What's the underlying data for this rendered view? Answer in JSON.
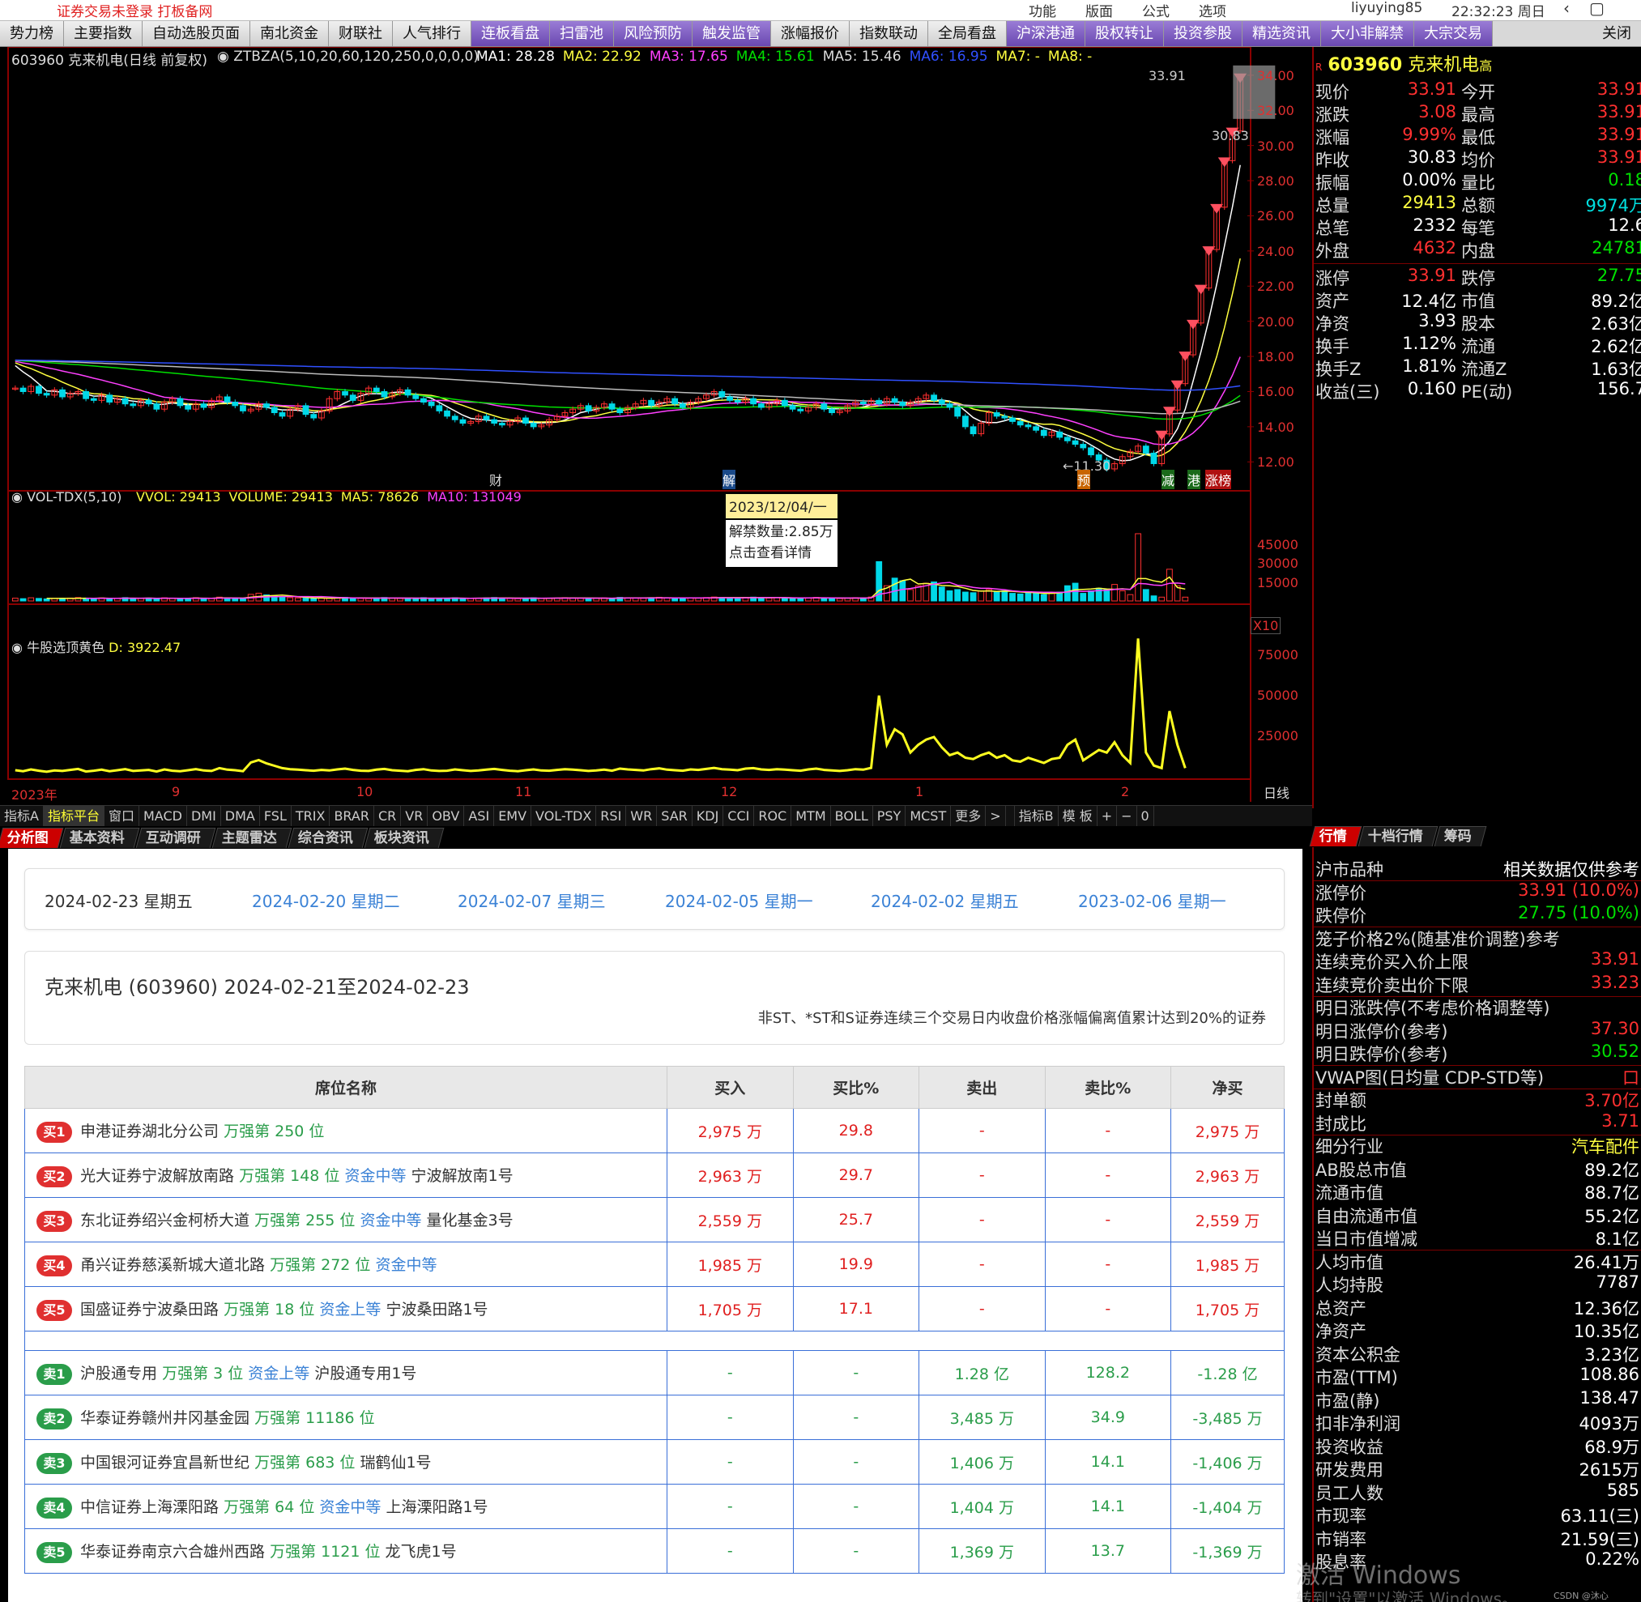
{
  "sysbar": {
    "warning": "证券交易未登录  打板备网",
    "menu": [
      "功能",
      "版面",
      "公式",
      "选项"
    ],
    "user": "liyuying85",
    "clock": "22:32:23 周日"
  },
  "tabs": [
    {
      "label": "势力榜",
      "hl": false
    },
    {
      "label": "主要指数",
      "hl": false
    },
    {
      "label": "自动选股页面",
      "hl": false
    },
    {
      "label": "南北资金",
      "hl": false
    },
    {
      "label": "财联社",
      "hl": false
    },
    {
      "label": "人气排行",
      "hl": false
    },
    {
      "label": "连板看盘",
      "hl": true
    },
    {
      "label": "扫雷池",
      "hl": true
    },
    {
      "label": "风险预防",
      "hl": true
    },
    {
      "label": "触发监管",
      "hl": true
    },
    {
      "label": "涨幅报价",
      "hl": false
    },
    {
      "label": "指数联动",
      "hl": false
    },
    {
      "label": "全局看盘",
      "hl": false
    },
    {
      "label": "沪深港通",
      "hl": true
    },
    {
      "label": "股权转让",
      "hl": true
    },
    {
      "label": "投资参股",
      "hl": true
    },
    {
      "label": "精选资讯",
      "hl": true
    },
    {
      "label": "大小非解禁",
      "hl": true
    },
    {
      "label": "大宗交易",
      "hl": true
    }
  ],
  "tab_close": "关闭",
  "kline": {
    "header": "603960 克来机电(日线 前复权)",
    "formula": "ZTBZA(5,10,20,60,120,250,0,0,0,0)",
    "ma": [
      {
        "label": "MA1: 28.28",
        "color": "#ffffff"
      },
      {
        "label": "MA2: 22.92",
        "color": "#ffff40"
      },
      {
        "label": "MA3: 17.65",
        "color": "#ff40ff"
      },
      {
        "label": "MA4: 15.61",
        "color": "#00e000"
      },
      {
        "label": "MA5: 15.46",
        "color": "#dddddd"
      },
      {
        "label": "MA6: 16.95",
        "color": "#3050ff"
      },
      {
        "label": "MA7: -",
        "color": "#ffff40"
      },
      {
        "label": "MA8: -",
        "color": "#ffff40"
      }
    ],
    "yticks": [
      "34.00",
      "32.00",
      "30.00",
      "28.00",
      "26.00",
      "24.00",
      "22.00",
      "20.00",
      "18.00",
      "16.00",
      "14.00",
      "12.00"
    ],
    "annotations": {
      "high": "33.91",
      "pre": "30.83",
      "low": "11.30"
    },
    "markers": [
      {
        "text": "财"
      },
      {
        "text": "解"
      },
      {
        "text": "预"
      },
      {
        "text": "减"
      },
      {
        "text": "港"
      },
      {
        "text": "涨榜"
      }
    ]
  },
  "tooltip": {
    "date": "2023/12/04/一",
    "line1": "解禁数量:2.85万",
    "line2": "点击查看详情"
  },
  "vol": {
    "header": "VOL-TDX(5,10)",
    "items": [
      {
        "label": "VVOL: 29413",
        "color": "#ffff40"
      },
      {
        "label": "VOLUME: 29413",
        "color": "#ffff40"
      },
      {
        "label": "MA5: 78626",
        "color": "#ffff40"
      },
      {
        "label": "MA10: 131049",
        "color": "#ff40ff"
      }
    ],
    "yticks": [
      "45000",
      "30000",
      "15000"
    ],
    "unit": "X10"
  },
  "osc": {
    "header": "牛股选顶黄色",
    "value": "D: 3922.47",
    "yticks": [
      "75000",
      "50000",
      "25000"
    ]
  },
  "xaxis": [
    "2023年",
    "9",
    "10",
    "11",
    "12",
    "1",
    "2"
  ],
  "period": "日线",
  "indicators": [
    "指标A",
    "指标平台",
    "窗口",
    "MACD",
    "DMI",
    "DMA",
    "FSL",
    "TRIX",
    "BRAR",
    "CR",
    "VR",
    "OBV",
    "ASI",
    "EMV",
    "VOL-TDX",
    "RSI",
    "WR",
    "SAR",
    "KDJ",
    "CCI",
    "ROC",
    "MTM",
    "BOLL",
    "PSY",
    "MCST",
    "更多",
    ">",
    "",
    "指标B",
    "模 板",
    "+",
    "−",
    "0"
  ],
  "subtabs": [
    "分析图",
    "基本资料",
    "互动调研",
    "主题雷达",
    "综合资讯",
    "板块资讯"
  ],
  "web": {
    "dates": [
      "2024-02-23 星期五",
      "2024-02-20 星期二",
      "2024-02-07 星期三",
      "2024-02-05 星期一",
      "2024-02-02 星期五",
      "2023-02-06 星期一"
    ],
    "title": "克来机电 (603960) 2024-02-21至2024-02-23",
    "reason": "非ST、*ST和S证券连续三个交易日内收盘价格涨幅偏离值累计达到20%的证券",
    "headers": [
      "席位名称",
      "买入",
      "买比%",
      "卖出",
      "卖比%",
      "净买"
    ],
    "buys": [
      {
        "badge": "买1",
        "name": "申港证券湖北分公司",
        "rank": "万强第 250 位",
        "level": "",
        "tag": "",
        "buy": "2,975 万",
        "buy_pct": "29.8",
        "sell": "-",
        "sell_pct": "-",
        "net": "2,975 万"
      },
      {
        "badge": "买2",
        "name": "光大证券宁波解放南路",
        "rank": "万强第 148 位",
        "level": "资金中等",
        "tag": "宁波解放南1号",
        "buy": "2,963 万",
        "buy_pct": "29.7",
        "sell": "-",
        "sell_pct": "-",
        "net": "2,963 万"
      },
      {
        "badge": "买3",
        "name": "东北证券绍兴金柯桥大道",
        "rank": "万强第 255 位",
        "level": "资金中等",
        "tag": "量化基金3号",
        "buy": "2,559 万",
        "buy_pct": "25.7",
        "sell": "-",
        "sell_pct": "-",
        "net": "2,559 万"
      },
      {
        "badge": "买4",
        "name": "甬兴证券慈溪新城大道北路",
        "rank": "万强第 272 位",
        "level": "资金中等",
        "tag": "",
        "buy": "1,985 万",
        "buy_pct": "19.9",
        "sell": "-",
        "sell_pct": "-",
        "net": "1,985 万"
      },
      {
        "badge": "买5",
        "name": "国盛证券宁波桑田路",
        "rank": "万强第 18 位",
        "level": "资金上等",
        "tag": "宁波桑田路1号",
        "buy": "1,705 万",
        "buy_pct": "17.1",
        "sell": "-",
        "sell_pct": "-",
        "net": "1,705 万"
      }
    ],
    "sells": [
      {
        "badge": "卖1",
        "name": "沪股通专用",
        "rank": "万强第 3 位",
        "level": "资金上等",
        "tag": "沪股通专用1号",
        "buy": "-",
        "buy_pct": "-",
        "sell": "1.28 亿",
        "sell_pct": "128.2",
        "net": "-1.28 亿"
      },
      {
        "badge": "卖2",
        "name": "华泰证券赣州井冈基金园",
        "rank": "万强第 11186 位",
        "level": "",
        "tag": "",
        "buy": "-",
        "buy_pct": "-",
        "sell": "3,485 万",
        "sell_pct": "34.9",
        "net": "-3,485 万"
      },
      {
        "badge": "卖3",
        "name": "中国银河证券宜昌新世纪",
        "rank": "万强第 683 位",
        "level": "",
        "tag": "瑞鹤仙1号",
        "buy": "-",
        "buy_pct": "-",
        "sell": "1,406 万",
        "sell_pct": "14.1",
        "net": "-1,406 万"
      },
      {
        "badge": "卖4",
        "name": "中信证券上海溧阳路",
        "rank": "万强第 64 位",
        "level": "资金中等",
        "tag": "上海溧阳路1号",
        "buy": "-",
        "buy_pct": "-",
        "sell": "1,404 万",
        "sell_pct": "14.1",
        "net": "-1,404 万"
      },
      {
        "badge": "卖5",
        "name": "华泰证券南京六合雄州西路",
        "rank": "万强第 1121 位",
        "level": "",
        "tag": "龙飞虎1号",
        "buy": "-",
        "buy_pct": "-",
        "sell": "1,369 万",
        "sell_pct": "13.7",
        "net": "-1,369 万"
      }
    ]
  },
  "quote": {
    "code": "603960",
    "name": "克来机电",
    "flag": "R",
    "suffix": "高",
    "rows": [
      {
        "l": "现价",
        "v": "33.91",
        "vc": "red",
        "l2": "今开",
        "v2": "33.91",
        "v2c": "red"
      },
      {
        "l": "涨跌",
        "v": "3.08",
        "vc": "red",
        "l2": "最高",
        "v2": "33.91",
        "v2c": "red"
      },
      {
        "l": "涨幅",
        "v": "9.99%",
        "vc": "red",
        "l2": "最低",
        "v2": "33.91",
        "v2c": "red"
      },
      {
        "l": "昨收",
        "v": "30.83",
        "vc": "wht",
        "l2": "均价",
        "v2": "33.91",
        "v2c": "red"
      },
      {
        "l": "振幅",
        "v": "0.00%",
        "vc": "wht",
        "l2": "量比",
        "v2": "0.18",
        "v2c": "grn"
      },
      {
        "l": "总量",
        "v": "29413",
        "vc": "yel",
        "l2": "总额",
        "v2": "9974万",
        "v2c": "cyan"
      },
      {
        "l": "总笔",
        "v": "2332",
        "vc": "wht",
        "l2": "每笔",
        "v2": "12.6",
        "v2c": "wht"
      },
      {
        "l": "外盘",
        "v": "4632",
        "vc": "red",
        "l2": "内盘",
        "v2": "24781",
        "v2c": "grn"
      },
      {
        "l": "涨停",
        "v": "33.91",
        "vc": "red",
        "l2": "跌停",
        "v2": "27.75",
        "v2c": "grn"
      },
      {
        "l": "资产",
        "v": "12.4亿",
        "vc": "wht",
        "l2": "市值",
        "v2": "89.2亿",
        "v2c": "wht"
      },
      {
        "l": "净资",
        "v": "3.93",
        "vc": "wht",
        "l2": "股本",
        "v2": "2.63亿",
        "v2c": "wht"
      },
      {
        "l": "换手",
        "v": "1.12%",
        "vc": "wht",
        "l2": "流通",
        "v2": "2.62亿",
        "v2c": "wht"
      },
      {
        "l": "换手Z",
        "v": "1.81%",
        "vc": "wht",
        "l2": "流通Z",
        "v2": "1.63亿",
        "v2c": "wht"
      },
      {
        "l": "收益(三)",
        "v": "0.160",
        "vc": "wht",
        "l2": "PE(动)",
        "v2": "156.7",
        "v2c": "wht"
      }
    ]
  },
  "qtabs": [
    "行情",
    "十档行情",
    "筹码"
  ],
  "detail": {
    "rows": [
      {
        "l": "沪市品种",
        "v": "相关数据仅供参考",
        "c": "wht"
      },
      {
        "l": "涨停价",
        "v": "33.91 (10.0%)",
        "c": "red"
      },
      {
        "l": "跌停价",
        "v": "27.75 (10.0%)",
        "c": "grn"
      },
      {
        "l": "笼子价格2%(随基准价调整)参考",
        "v": "",
        "c": "wht"
      },
      {
        "l": "连续竞价买入价上限",
        "v": "33.91",
        "c": "red"
      },
      {
        "l": "连续竞价卖出价下限",
        "v": "33.23",
        "c": "red"
      },
      {
        "l": "明日涨跌停(不考虑价格调整等)",
        "v": "",
        "c": "wht"
      },
      {
        "l": "明日涨停价(参考)",
        "v": "37.30",
        "c": "red"
      },
      {
        "l": "明日跌停价(参考)",
        "v": "30.52",
        "c": "grn"
      },
      {
        "l": "VWAP图(日均量 CDP-STD等)",
        "v": "口",
        "c": "red"
      },
      {
        "l": "封单额",
        "v": "3.70亿",
        "c": "red"
      },
      {
        "l": "封成比",
        "v": "3.71",
        "c": "red"
      },
      {
        "l": "细分行业",
        "v": "汽车配件",
        "c": "yel"
      },
      {
        "l": "AB股总市值",
        "v": "89.2亿",
        "c": "wht"
      },
      {
        "l": "流通市值",
        "v": "88.7亿",
        "c": "wht"
      },
      {
        "l": "自由流通市值",
        "v": "55.2亿",
        "c": "wht"
      },
      {
        "l": "当日市值增减",
        "v": "8.1亿",
        "c": "wht"
      },
      {
        "l": "人均市值",
        "v": "26.41万",
        "c": "wht"
      },
      {
        "l": "人均持股",
        "v": "7787",
        "c": "wht"
      },
      {
        "l": "总资产",
        "v": "12.36亿",
        "c": "wht"
      },
      {
        "l": "净资产",
        "v": "10.35亿",
        "c": "wht"
      },
      {
        "l": "资本公积金",
        "v": "3.23亿",
        "c": "wht"
      },
      {
        "l": "市盈(TTM)",
        "v": "108.86",
        "c": "wht"
      },
      {
        "l": "市盈(静)",
        "v": "138.47",
        "c": "wht"
      },
      {
        "l": "扣非净利润",
        "v": "4093万",
        "c": "wht"
      },
      {
        "l": "投资收益",
        "v": "68.9万",
        "c": "wht"
      },
      {
        "l": "研发费用",
        "v": "2615万",
        "c": "wht"
      },
      {
        "l": "员工人数",
        "v": "585",
        "c": "wht"
      },
      {
        "l": "市现率",
        "v": "63.11(三)",
        "c": "wht"
      },
      {
        "l": "市销率",
        "v": "21.59(三)",
        "c": "wht"
      },
      {
        "l": "股息率",
        "v": "0.22%",
        "c": "wht"
      }
    ]
  },
  "watermark": {
    "line1": "激活 Windows",
    "line2": "转到\"设置\"以激活 Windows。",
    "credit": "CSDN @沐心"
  },
  "chart_data": {
    "type": "candlestick",
    "price_range": [
      11,
      34.5
    ],
    "closes": [
      16.2,
      16.0,
      16.3,
      15.9,
      15.8,
      16.1,
      15.7,
      15.9,
      16.0,
      15.6,
      15.5,
      15.8,
      15.4,
      15.6,
      15.3,
      15.2,
      15.5,
      15.3,
      15.0,
      15.4,
      15.6,
      15.2,
      15.0,
      15.3,
      15.1,
      15.5,
      15.7,
      15.4,
      15.2,
      14.9,
      15.0,
      15.3,
      15.1,
      14.8,
      14.6,
      15.0,
      15.2,
      14.7,
      14.5,
      14.9,
      15.6,
      16.0,
      15.8,
      15.5,
      15.9,
      16.2,
      16.0,
      15.7,
      15.9,
      16.1,
      15.8,
      15.6,
      15.4,
      15.2,
      14.9,
      14.6,
      14.4,
      14.2,
      14.3,
      14.6,
      14.4,
      14.2,
      14.1,
      14.3,
      14.5,
      14.2,
      14.0,
      14.1,
      14.4,
      14.6,
      14.8,
      15.0,
      15.2,
      14.9,
      15.1,
      15.3,
      15.0,
      14.8,
      15.1,
      15.3,
      15.5,
      15.2,
      15.4,
      15.6,
      15.3,
      15.1,
      15.4,
      15.6,
      15.8,
      16.0,
      15.7,
      15.5,
      15.4,
      15.6,
      15.3,
      15.1,
      15.3,
      15.5,
      15.2,
      15.0,
      14.9,
      15.1,
      15.3,
      15.0,
      14.8,
      14.9,
      15.2,
      15.4,
      15.3,
      15.5,
      15.3,
      15.6,
      15.4,
      15.2,
      15.4,
      15.6,
      15.8,
      15.5,
      15.3,
      15.1,
      14.6,
      14.0,
      13.6,
      14.2,
      14.8,
      14.6,
      14.5,
      14.3,
      14.1,
      14.0,
      13.8,
      13.5,
      13.7,
      13.4,
      13.2,
      13.0,
      12.8,
      12.4,
      12.1,
      11.6,
      11.9,
      12.3,
      12.6,
      12.9,
      12.5,
      11.9,
      13.59,
      14.95,
      16.45,
      18.09,
      19.9,
      21.89,
      24.08,
      26.49,
      29.14,
      30.83,
      33.91
    ],
    "volumes": [
      2200,
      1800,
      2500,
      2000,
      1600,
      2100,
      1900,
      2300,
      2700,
      1700,
      2000,
      2400,
      1800,
      2200,
      2600,
      1900,
      2100,
      2300,
      1700,
      2500,
      2000,
      1800,
      2200,
      2600,
      2100,
      1900,
      3000,
      2400,
      2200,
      1800,
      5200,
      6100,
      4800,
      3900,
      3000,
      2600,
      2400,
      2200,
      2000,
      2300,
      2100,
      2500,
      2800,
      2300,
      2000,
      1900,
      2400,
      2700,
      2200,
      2000,
      1800,
      2300,
      2600,
      2100,
      1900,
      2000,
      2500,
      2200,
      1900,
      2100,
      2400,
      2700,
      2300,
      2000,
      1800,
      2200,
      2500,
      2100,
      2000,
      2300,
      2600,
      2400,
      2200,
      1900,
      2100,
      2400,
      2000,
      2800,
      2500,
      2300,
      2100,
      2600,
      2900,
      2400,
      2200,
      2000,
      2500,
      2300,
      2700,
      3100,
      2600,
      2400,
      2200,
      2800,
      3000,
      2500,
      2300,
      2600,
      2400,
      2200,
      2000,
      2500,
      2800,
      2300,
      2100,
      1900,
      2200,
      2600,
      2400,
      3100,
      31000,
      12000,
      18000,
      16000,
      9000,
      12000,
      14000,
      15000,
      11000,
      8000,
      9000,
      7000,
      6500,
      8000,
      9000,
      7000,
      8000,
      6000,
      5500,
      7000,
      6000,
      5000,
      6500,
      7000,
      12000,
      14000,
      6000,
      8000,
      10000,
      9000,
      13000,
      8000,
      5000,
      53000,
      9000,
      4000,
      3000,
      25000,
      12000,
      3000
    ]
  }
}
